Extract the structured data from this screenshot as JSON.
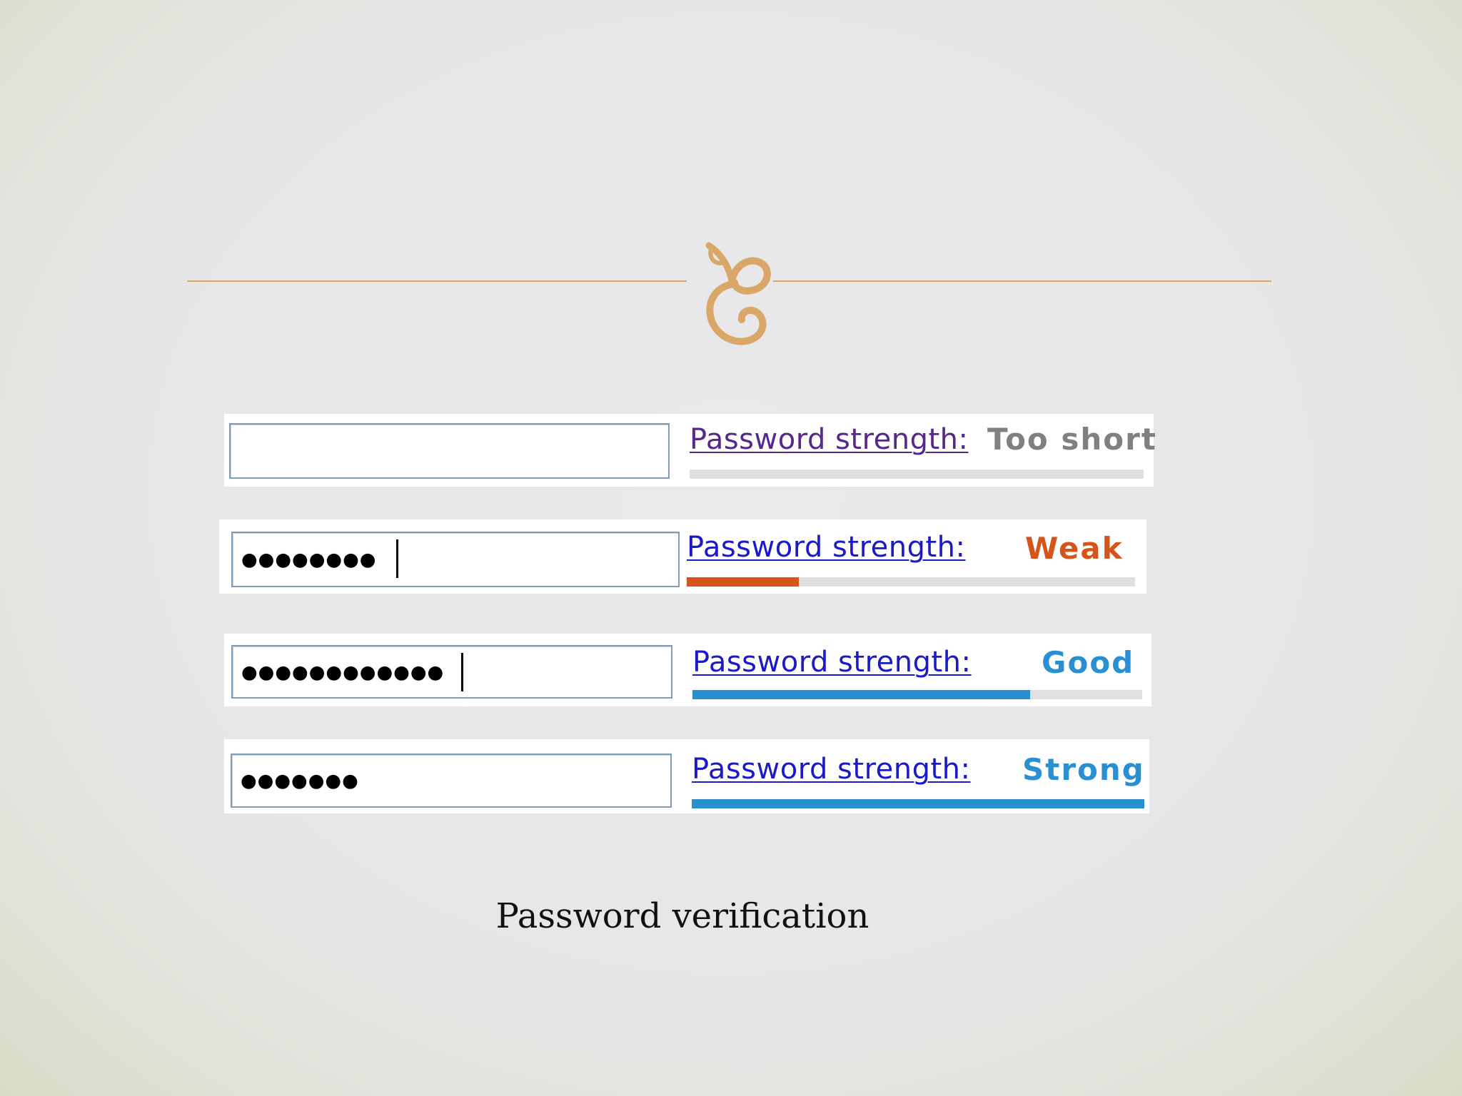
{
  "colors": {
    "ornament": "#d9a868",
    "link_visited": "#55288a",
    "link": "#1a1ac8",
    "too_short": "#808080",
    "weak": "#d4541a",
    "good_strong": "#2a8fd1",
    "meter_track": "#e0e0e0"
  },
  "ornament_icon": "leaf-flourish",
  "rows": [
    {
      "masked_value": "",
      "show_caret": false,
      "link_label": "Password strength:",
      "strength_label": "Too short",
      "strength_fraction": 0.0
    },
    {
      "masked_value": "●●●●●●●●",
      "show_caret": true,
      "link_label": "Password strength:",
      "strength_label": "Weak",
      "strength_fraction": 0.25
    },
    {
      "masked_value": "●●●●●●●●●●●●",
      "show_caret": true,
      "link_label": "Password strength:",
      "strength_label": "Good",
      "strength_fraction": 0.75
    },
    {
      "masked_value": "●●●●●●●",
      "show_caret": false,
      "link_label": "Password strength:",
      "strength_label": "Strong",
      "strength_fraction": 1.0
    }
  ],
  "caption": "Password verification"
}
